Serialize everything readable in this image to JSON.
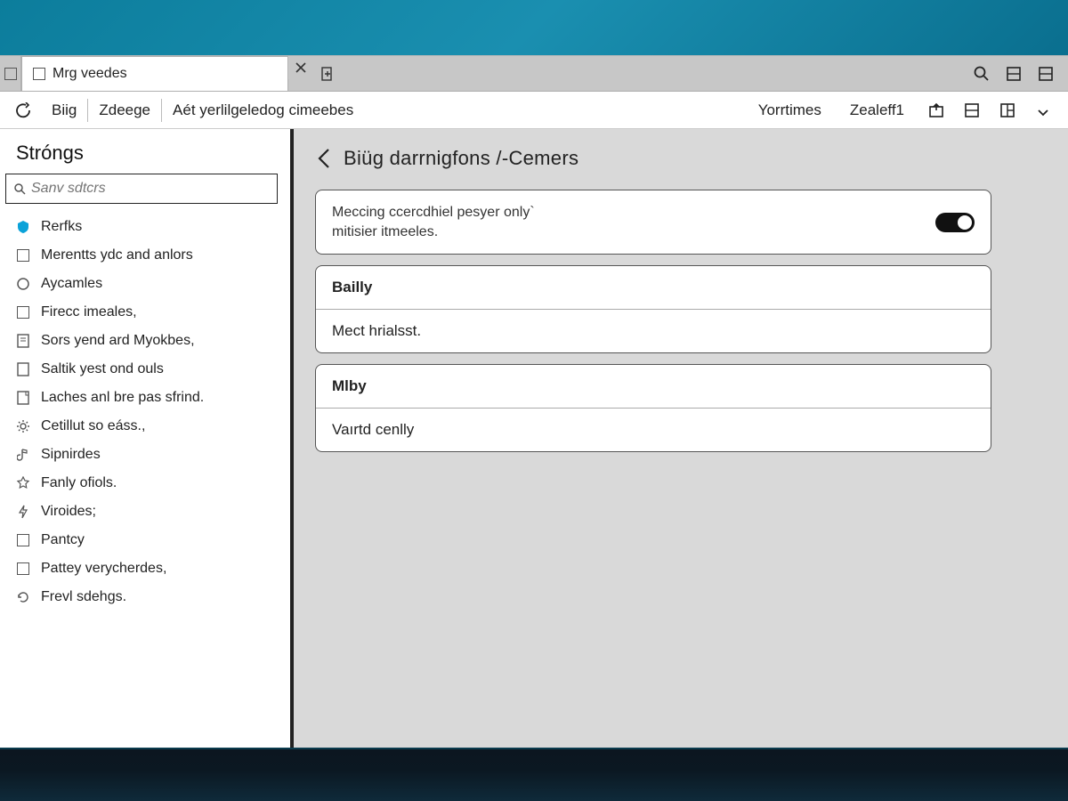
{
  "tab": {
    "title": "Mrg veedes"
  },
  "toolbar": {
    "item1": "Biig",
    "item2": "Zdeege",
    "item3": "Aét yerlilgeledog cimeebes",
    "right1": "Yorrtimes",
    "right2": "Zealeff1"
  },
  "sidebar": {
    "title": "Stróngs",
    "search_placeholder": "Sanv sdtcrs",
    "items": [
      "Rerfks",
      "Merentts ydc and anlors",
      "Aycamles",
      "Firecc imeales,",
      "Sors yend ard Myokbes,",
      "Saltik yest ond ouls",
      "Laches anl bre pas sfrind.",
      "Cetillut so eáss.,",
      "Sipnirdes",
      "Fanly ofiols.",
      "Viroides;",
      "Pantcy",
      "Pattey verycherdes,",
      "Frevl sdehgs."
    ]
  },
  "main": {
    "title": "Biüg darrnigfons /-Cemers",
    "toggle_card": {
      "line1": "Meccing ccercdhiel pesyer only`",
      "line2": "mitisier itmeeles."
    },
    "card2": {
      "head": "Bailly",
      "row": "Mect hrialsst."
    },
    "card3": {
      "head": "Mlby",
      "row": "Vaırtd cenlly"
    }
  }
}
